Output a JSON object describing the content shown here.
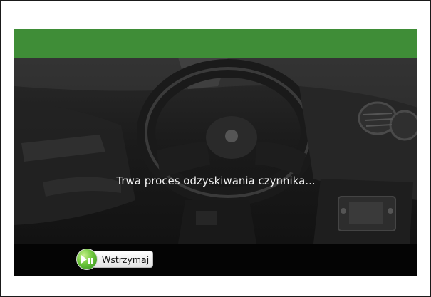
{
  "status": {
    "message": "Trwa proces odzyskiwania czynnika..."
  },
  "controls": {
    "pause_label": "Wstrzymaj"
  },
  "colors": {
    "header_green": "#3f8d37",
    "button_green": "#6cc63a"
  },
  "icons": {
    "pause": "play-pause-icon"
  }
}
